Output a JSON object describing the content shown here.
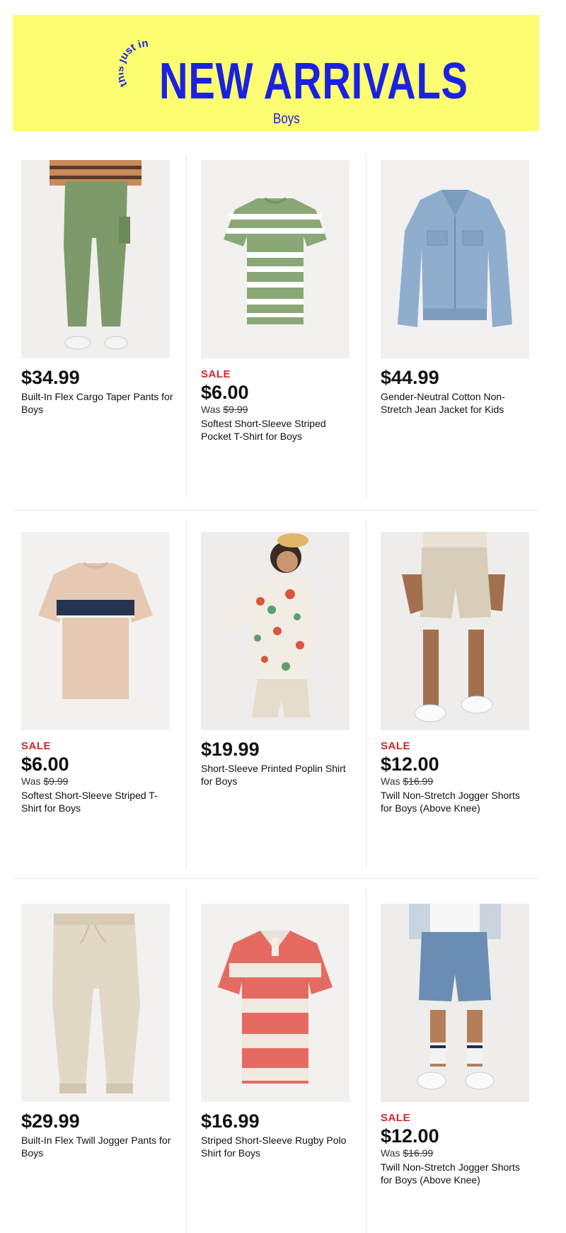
{
  "banner": {
    "kicker": "this just in",
    "title": "NEW ARRIVALS",
    "subtitle": "Boys"
  },
  "colors": {
    "banner_bg": "#fdfd72",
    "banner_text": "#1a22e0",
    "sale_red": "#d2262b"
  },
  "products": [
    {
      "image": "green-cargo-pants-photo",
      "sale": "",
      "price": "$34.99",
      "was_label": "",
      "was_price": "",
      "name": "Built-In Flex Cargo Taper Pants for Boys"
    },
    {
      "image": "green-striped-tshirt-photo",
      "sale": "SALE",
      "price": "$6.00",
      "was_label": "Was",
      "was_price": "$9.99",
      "name": "Softest Short-Sleeve Striped Pocket T-Shirt for Boys"
    },
    {
      "image": "denim-jacket-photo",
      "sale": "",
      "price": "$44.99",
      "was_label": "",
      "was_price": "",
      "name": "Gender-Neutral Cotton Non-Stretch Jean Jacket for Kids"
    },
    {
      "image": "tan-navy-stripe-tshirt-photo",
      "sale": "SALE",
      "price": "$6.00",
      "was_label": "Was",
      "was_price": "$9.99",
      "name": "Softest Short-Sleeve Striped T-Shirt for Boys"
    },
    {
      "image": "floral-poplin-shirt-photo",
      "sale": "",
      "price": "$19.99",
      "was_label": "",
      "was_price": "",
      "name": "Short-Sleeve Printed Poplin Shirt for Boys"
    },
    {
      "image": "khaki-jogger-shorts-photo",
      "sale": "SALE",
      "price": "$12.00",
      "was_label": "Was",
      "was_price": "$16.99",
      "name": "Twill Non-Stretch Jogger Shorts for Boys (Above Knee)"
    },
    {
      "image": "beige-jogger-pants-photo",
      "sale": "",
      "price": "$29.99",
      "was_label": "",
      "was_price": "",
      "name": "Built-In Flex Twill Jogger Pants for Boys"
    },
    {
      "image": "red-striped-rugby-polo-photo",
      "sale": "",
      "price": "$16.99",
      "was_label": "",
      "was_price": "",
      "name": "Striped Short-Sleeve Rugby Polo Shirt for Boys"
    },
    {
      "image": "blue-jogger-shorts-photo",
      "sale": "SALE",
      "price": "$12.00",
      "was_label": "Was",
      "was_price": "$16.99",
      "name": "Twill Non-Stretch Jogger Shorts for Boys (Above Knee)"
    }
  ]
}
